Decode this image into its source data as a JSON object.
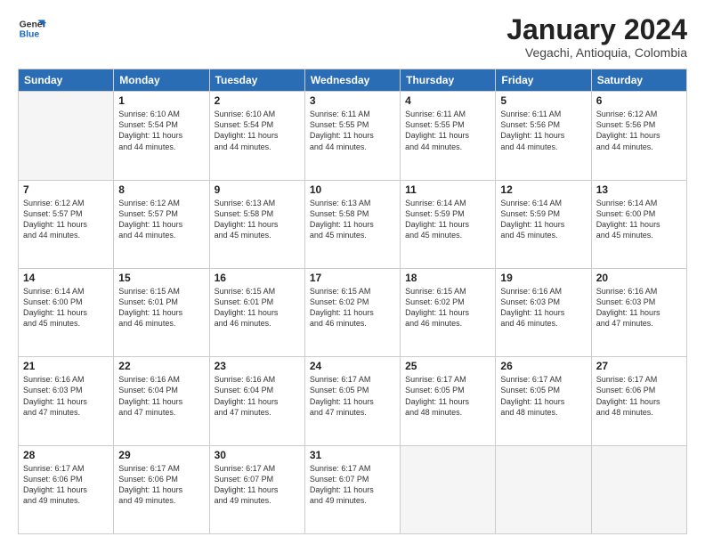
{
  "logo": {
    "line1": "General",
    "line2": "Blue"
  },
  "title": "January 2024",
  "subtitle": "Vegachi, Antioquia, Colombia",
  "days_header": [
    "Sunday",
    "Monday",
    "Tuesday",
    "Wednesday",
    "Thursday",
    "Friday",
    "Saturday"
  ],
  "weeks": [
    [
      {
        "day": "",
        "info": ""
      },
      {
        "day": "1",
        "info": "Sunrise: 6:10 AM\nSunset: 5:54 PM\nDaylight: 11 hours\nand 44 minutes."
      },
      {
        "day": "2",
        "info": "Sunrise: 6:10 AM\nSunset: 5:54 PM\nDaylight: 11 hours\nand 44 minutes."
      },
      {
        "day": "3",
        "info": "Sunrise: 6:11 AM\nSunset: 5:55 PM\nDaylight: 11 hours\nand 44 minutes."
      },
      {
        "day": "4",
        "info": "Sunrise: 6:11 AM\nSunset: 5:55 PM\nDaylight: 11 hours\nand 44 minutes."
      },
      {
        "day": "5",
        "info": "Sunrise: 6:11 AM\nSunset: 5:56 PM\nDaylight: 11 hours\nand 44 minutes."
      },
      {
        "day": "6",
        "info": "Sunrise: 6:12 AM\nSunset: 5:56 PM\nDaylight: 11 hours\nand 44 minutes."
      }
    ],
    [
      {
        "day": "7",
        "info": "Sunrise: 6:12 AM\nSunset: 5:57 PM\nDaylight: 11 hours\nand 44 minutes."
      },
      {
        "day": "8",
        "info": "Sunrise: 6:12 AM\nSunset: 5:57 PM\nDaylight: 11 hours\nand 44 minutes."
      },
      {
        "day": "9",
        "info": "Sunrise: 6:13 AM\nSunset: 5:58 PM\nDaylight: 11 hours\nand 45 minutes."
      },
      {
        "day": "10",
        "info": "Sunrise: 6:13 AM\nSunset: 5:58 PM\nDaylight: 11 hours\nand 45 minutes."
      },
      {
        "day": "11",
        "info": "Sunrise: 6:14 AM\nSunset: 5:59 PM\nDaylight: 11 hours\nand 45 minutes."
      },
      {
        "day": "12",
        "info": "Sunrise: 6:14 AM\nSunset: 5:59 PM\nDaylight: 11 hours\nand 45 minutes."
      },
      {
        "day": "13",
        "info": "Sunrise: 6:14 AM\nSunset: 6:00 PM\nDaylight: 11 hours\nand 45 minutes."
      }
    ],
    [
      {
        "day": "14",
        "info": "Sunrise: 6:14 AM\nSunset: 6:00 PM\nDaylight: 11 hours\nand 45 minutes."
      },
      {
        "day": "15",
        "info": "Sunrise: 6:15 AM\nSunset: 6:01 PM\nDaylight: 11 hours\nand 46 minutes."
      },
      {
        "day": "16",
        "info": "Sunrise: 6:15 AM\nSunset: 6:01 PM\nDaylight: 11 hours\nand 46 minutes."
      },
      {
        "day": "17",
        "info": "Sunrise: 6:15 AM\nSunset: 6:02 PM\nDaylight: 11 hours\nand 46 minutes."
      },
      {
        "day": "18",
        "info": "Sunrise: 6:15 AM\nSunset: 6:02 PM\nDaylight: 11 hours\nand 46 minutes."
      },
      {
        "day": "19",
        "info": "Sunrise: 6:16 AM\nSunset: 6:03 PM\nDaylight: 11 hours\nand 46 minutes."
      },
      {
        "day": "20",
        "info": "Sunrise: 6:16 AM\nSunset: 6:03 PM\nDaylight: 11 hours\nand 47 minutes."
      }
    ],
    [
      {
        "day": "21",
        "info": "Sunrise: 6:16 AM\nSunset: 6:03 PM\nDaylight: 11 hours\nand 47 minutes."
      },
      {
        "day": "22",
        "info": "Sunrise: 6:16 AM\nSunset: 6:04 PM\nDaylight: 11 hours\nand 47 minutes."
      },
      {
        "day": "23",
        "info": "Sunrise: 6:16 AM\nSunset: 6:04 PM\nDaylight: 11 hours\nand 47 minutes."
      },
      {
        "day": "24",
        "info": "Sunrise: 6:17 AM\nSunset: 6:05 PM\nDaylight: 11 hours\nand 47 minutes."
      },
      {
        "day": "25",
        "info": "Sunrise: 6:17 AM\nSunset: 6:05 PM\nDaylight: 11 hours\nand 48 minutes."
      },
      {
        "day": "26",
        "info": "Sunrise: 6:17 AM\nSunset: 6:05 PM\nDaylight: 11 hours\nand 48 minutes."
      },
      {
        "day": "27",
        "info": "Sunrise: 6:17 AM\nSunset: 6:06 PM\nDaylight: 11 hours\nand 48 minutes."
      }
    ],
    [
      {
        "day": "28",
        "info": "Sunrise: 6:17 AM\nSunset: 6:06 PM\nDaylight: 11 hours\nand 49 minutes."
      },
      {
        "day": "29",
        "info": "Sunrise: 6:17 AM\nSunset: 6:06 PM\nDaylight: 11 hours\nand 49 minutes."
      },
      {
        "day": "30",
        "info": "Sunrise: 6:17 AM\nSunset: 6:07 PM\nDaylight: 11 hours\nand 49 minutes."
      },
      {
        "day": "31",
        "info": "Sunrise: 6:17 AM\nSunset: 6:07 PM\nDaylight: 11 hours\nand 49 minutes."
      },
      {
        "day": "",
        "info": ""
      },
      {
        "day": "",
        "info": ""
      },
      {
        "day": "",
        "info": ""
      }
    ]
  ]
}
